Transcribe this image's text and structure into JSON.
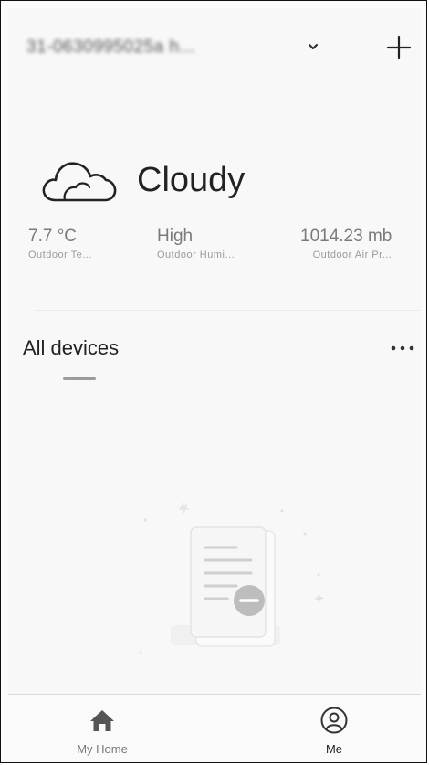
{
  "header": {
    "home_name": "31-0630995025a h...",
    "dropdown_icon": "chevron-down-icon",
    "add_icon": "plus-icon"
  },
  "weather": {
    "icon": "cloud-icon",
    "condition": "Cloudy",
    "stats": [
      {
        "value": "7.7 °C",
        "label": "Outdoor Te..."
      },
      {
        "value": "High",
        "label": "Outdoor Humi..."
      },
      {
        "value": "1014.23 mb",
        "label": "Outdoor Air Pr..."
      }
    ]
  },
  "devices": {
    "title": "All devices",
    "more_icon": "more-horizontal-icon",
    "empty_icon": "empty-document-illustration"
  },
  "tabbar": {
    "tabs": [
      {
        "label": "My Home",
        "icon": "home-icon",
        "active": false
      },
      {
        "label": "Me",
        "icon": "user-icon",
        "active": true
      }
    ]
  },
  "colors": {
    "background": "#f8f8f8",
    "text_primary": "#222222",
    "text_secondary": "#7a7a7a",
    "icon_dark": "#444444"
  }
}
